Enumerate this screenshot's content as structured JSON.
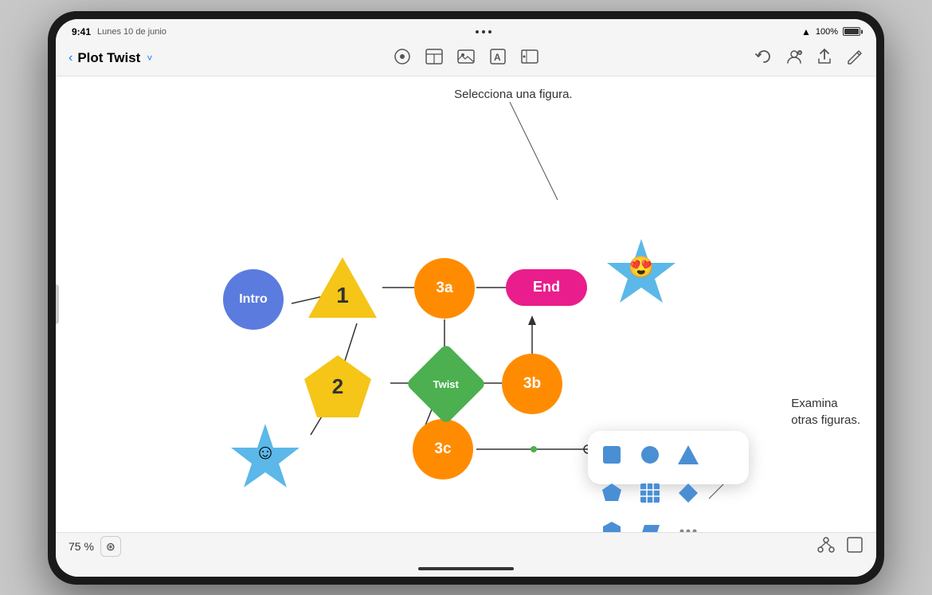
{
  "device": {
    "time": "9:41",
    "date": "Lunes 10 de junio",
    "battery": "100%",
    "wifi": true
  },
  "toolbar": {
    "back_label": "‹",
    "title": "Plot Twist",
    "chevron": "˅",
    "center_icons": [
      "⊙",
      "⊞",
      "⊡",
      "A",
      "⊟"
    ],
    "right_icons": [
      "↺",
      "👤",
      "↑",
      "✎"
    ]
  },
  "canvas": {
    "annotation_top": "Selecciona una figura.",
    "annotation_right_line1": "Examina",
    "annotation_right_line2": "otras figuras."
  },
  "diagram": {
    "nodes": [
      {
        "id": "intro",
        "label": "Intro",
        "shape": "circle",
        "color": "#5B7CDE"
      },
      {
        "id": "n1",
        "label": "1",
        "shape": "triangle",
        "color": "#F5C518"
      },
      {
        "id": "n2",
        "label": "2",
        "shape": "pentagon",
        "color": "#F5C518"
      },
      {
        "id": "n3a",
        "label": "3a",
        "shape": "circle",
        "color": "#FF8C00"
      },
      {
        "id": "n3b",
        "label": "3b",
        "shape": "circle",
        "color": "#FF8C00"
      },
      {
        "id": "n3c",
        "label": "3c",
        "shape": "circle",
        "color": "#FF8C00"
      },
      {
        "id": "twist",
        "label": "Twist",
        "shape": "diamond",
        "color": "#4CAF50"
      },
      {
        "id": "end",
        "label": "End",
        "shape": "pill",
        "color": "#E91E8C"
      },
      {
        "id": "star1",
        "label": "😍",
        "shape": "star",
        "color": "#5BB8E8"
      },
      {
        "id": "star2",
        "label": "☺",
        "shape": "star",
        "color": "#5BB8E8"
      }
    ]
  },
  "shape_panel": {
    "shapes": [
      "square",
      "circle",
      "triangle",
      "pentagon",
      "grid",
      "diamond",
      "hexagon",
      "parallelogram",
      "more"
    ]
  },
  "bottom": {
    "zoom": "75 %",
    "zoom_icon": "⊛",
    "right_icons": [
      "⋈",
      "⊡"
    ]
  }
}
